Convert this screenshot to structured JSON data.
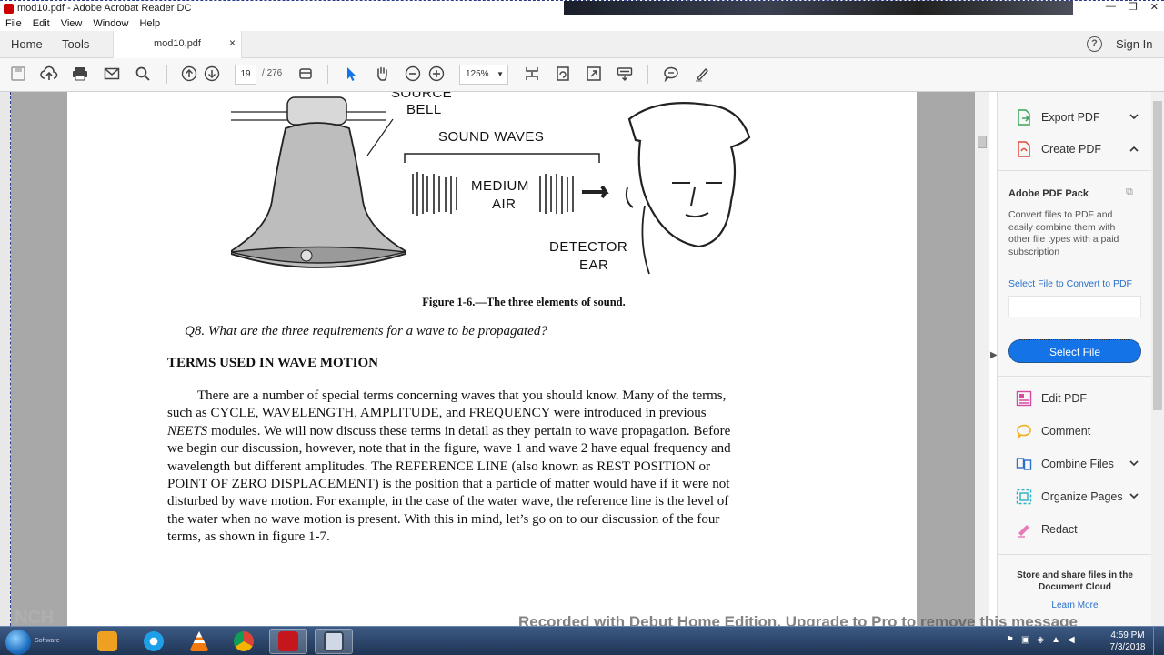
{
  "window": {
    "title": "mod10.pdf - Adobe Acrobat Reader DC",
    "controls": [
      "—",
      "❐",
      "✕"
    ]
  },
  "menu": [
    "File",
    "Edit",
    "View",
    "Window",
    "Help"
  ],
  "tabs": {
    "home": "Home",
    "tools": "Tools",
    "document": "mod10.pdf",
    "close": "×",
    "help": "?",
    "signin": "Sign In"
  },
  "toolbar": {
    "page_current": "19",
    "page_sep": "/",
    "page_total": "276",
    "zoom": "125%"
  },
  "figure": {
    "source_label_1": "SOURCE",
    "source_label_2": "BELL",
    "waves_label": "SOUND  WAVES",
    "medium_label_1": "MEDIUM",
    "medium_label_2": "AIR",
    "detector_label_1": "DETECTOR",
    "detector_label_2": "EAR"
  },
  "document": {
    "caption": "Figure 1-6.—The three elements of sound.",
    "question": "Q8.   What are the three requirements for a wave to be propagated?",
    "heading": "TERMS USED IN WAVE MOTION",
    "paragraph_lines": [
      "There are a number of special terms concerning waves that you should know. Many of the terms,",
      "such as CYCLE, WAVELENGTH, AMPLITUDE, and FREQUENCY were introduced in previous",
      "NEETS modules. We will now discuss these terms in detail as they pertain to wave propagation. Before",
      "we begin our discussion, however, note that in the figure, wave 1 and wave 2 have equal frequency and",
      "wavelength but different amplitudes. The REFERENCE LINE (also known as REST POSITION or",
      "POINT OF ZERO DISPLACEMENT) is the position that a particle of matter would have if it were not",
      "disturbed by wave motion. For example, in the case of the water wave, the reference line is the level of",
      "the water when no wave motion is present. With this in mind, let’s go on to our discussion of the four",
      "terms, as shown in figure 1-7."
    ]
  },
  "right_panel": {
    "export_pdf": "Export PDF",
    "create_pdf": "Create PDF",
    "pack_title": "Adobe PDF Pack",
    "pack_desc": "Convert files to PDF and easily combine them with other file types with a paid subscription",
    "select_link": "Select File to Convert to PDF",
    "select_button": "Select File",
    "edit_pdf": "Edit PDF",
    "comment": "Comment",
    "combine_files": "Combine Files",
    "organize_pages": "Organize Pages",
    "redact": "Redact",
    "cloud_text": "Store and share files in the Document Cloud",
    "learn_more": "Learn More"
  },
  "overlay": {
    "watermark": "Recorded with Debut Home Edition. Upgrade to Pro to remove this message",
    "nch": "NCH",
    "software": "Software"
  },
  "taskbar": {
    "time": "4:59 PM",
    "date": "7/3/2018"
  },
  "colors": {
    "accent": "#1473e6",
    "taskbar": "#1f3454"
  }
}
